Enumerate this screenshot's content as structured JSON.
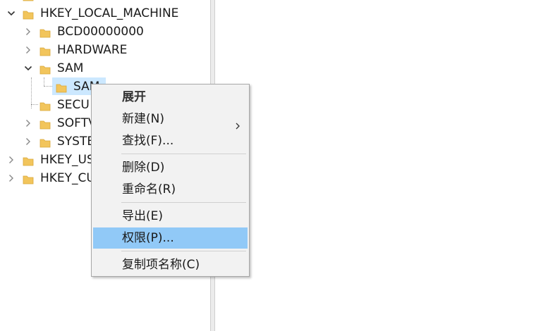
{
  "tree": {
    "items": [
      {
        "label": "HKEY_LOCAL_MACHINE",
        "chevron": "down"
      },
      {
        "label": "BCD00000000",
        "chevron": "right"
      },
      {
        "label": "HARDWARE",
        "chevron": "right"
      },
      {
        "label": "SAM",
        "chevron": "down"
      },
      {
        "label": "SAM",
        "chevron": "none",
        "selected": true
      },
      {
        "label": "SECU",
        "chevron": "none"
      },
      {
        "label": "SOFTV",
        "chevron": "right"
      },
      {
        "label": "SYSTE",
        "chevron": "right"
      },
      {
        "label": "HKEY_US",
        "chevron": "right"
      },
      {
        "label": "HKEY_CU",
        "chevron": "right"
      }
    ]
  },
  "context_menu": {
    "items": [
      {
        "label": "展开",
        "bold": true
      },
      {
        "label": "新建(N)",
        "submenu": true
      },
      {
        "label": "查找(F)..."
      },
      {
        "label": "删除(D)"
      },
      {
        "label": "重命名(R)"
      },
      {
        "label": "导出(E)"
      },
      {
        "label": "权限(P)...",
        "highlighted": true
      },
      {
        "label": "复制项名称(C)"
      }
    ]
  },
  "colors": {
    "folder": "#f2c55c",
    "selection": "#cce8ff",
    "menu_highlight": "#91c9f7",
    "menu_background": "#f2f2f2"
  }
}
